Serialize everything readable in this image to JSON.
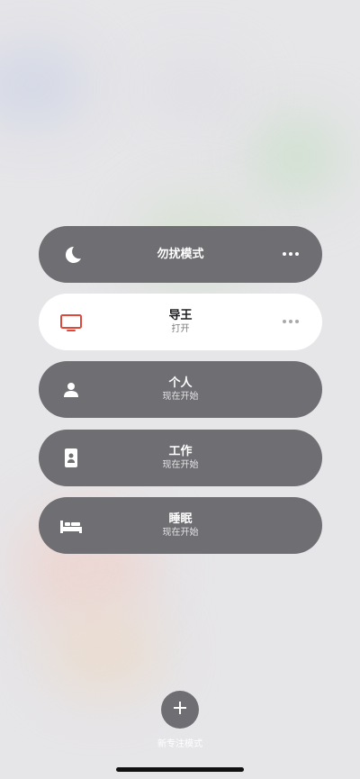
{
  "focus_modes": [
    {
      "title": "勿扰模式",
      "subtitle": "",
      "icon": "moon-icon",
      "selected": false,
      "has_more": true
    },
    {
      "title": "导王",
      "subtitle": "打开",
      "icon": "tv-icon",
      "selected": true,
      "has_more": true
    },
    {
      "title": "个人",
      "subtitle": "现在开始",
      "icon": "person-icon",
      "selected": false,
      "has_more": false
    },
    {
      "title": "工作",
      "subtitle": "现在开始",
      "icon": "id-badge-icon",
      "selected": false,
      "has_more": false
    },
    {
      "title": "睡眠",
      "subtitle": "现在开始",
      "icon": "bed-icon",
      "selected": false,
      "has_more": false
    }
  ],
  "add_button": {
    "label": "新专注模式",
    "icon": "plus-icon"
  },
  "colors": {
    "pill_bg": "#6f6e72",
    "selected_bg": "#ffffff",
    "accent_red": "#e0483a"
  }
}
